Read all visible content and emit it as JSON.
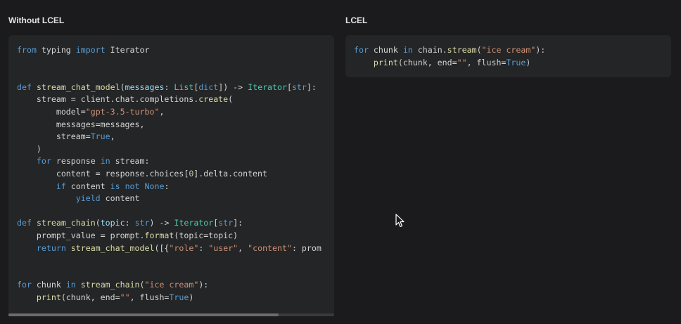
{
  "left_panel": {
    "title": "Without LCEL",
    "code_lines": [
      [
        {
          "t": "from",
          "c": "kw"
        },
        {
          "t": " typing ",
          "c": "pl"
        },
        {
          "t": "import",
          "c": "kw"
        },
        {
          "t": " Iterator",
          "c": "pl"
        }
      ],
      [],
      [],
      [
        {
          "t": "def",
          "c": "kw"
        },
        {
          "t": " ",
          "c": "pl"
        },
        {
          "t": "stream_chat_model",
          "c": "fn"
        },
        {
          "t": "(",
          "c": "pl"
        },
        {
          "t": "messages",
          "c": "id"
        },
        {
          "t": ": ",
          "c": "pl"
        },
        {
          "t": "List",
          "c": "ty"
        },
        {
          "t": "[",
          "c": "pl"
        },
        {
          "t": "dict",
          "c": "kw"
        },
        {
          "t": "]) -> ",
          "c": "pl"
        },
        {
          "t": "Iterator",
          "c": "ty"
        },
        {
          "t": "[",
          "c": "pl"
        },
        {
          "t": "str",
          "c": "kw"
        },
        {
          "t": "]:",
          "c": "pl"
        }
      ],
      [
        {
          "t": "    stream = client.chat.completions.",
          "c": "pl"
        },
        {
          "t": "create",
          "c": "fn"
        },
        {
          "t": "(",
          "c": "pl"
        }
      ],
      [
        {
          "t": "        model=",
          "c": "pl"
        },
        {
          "t": "\"gpt-3.5-turbo\"",
          "c": "st"
        },
        {
          "t": ",",
          "c": "pl"
        }
      ],
      [
        {
          "t": "        messages=messages,",
          "c": "pl"
        }
      ],
      [
        {
          "t": "        stream=",
          "c": "pl"
        },
        {
          "t": "True",
          "c": "kw"
        },
        {
          "t": ",",
          "c": "pl"
        }
      ],
      [
        {
          "t": "    )",
          "c": "pl"
        }
      ],
      [
        {
          "t": "    ",
          "c": "pl"
        },
        {
          "t": "for",
          "c": "kw"
        },
        {
          "t": " response ",
          "c": "pl"
        },
        {
          "t": "in",
          "c": "kw"
        },
        {
          "t": " stream:",
          "c": "pl"
        }
      ],
      [
        {
          "t": "        content = response.choices[",
          "c": "pl"
        },
        {
          "t": "0",
          "c": "nm"
        },
        {
          "t": "].delta.content",
          "c": "pl"
        }
      ],
      [
        {
          "t": "        ",
          "c": "pl"
        },
        {
          "t": "if",
          "c": "kw"
        },
        {
          "t": " content ",
          "c": "pl"
        },
        {
          "t": "is not",
          "c": "kw"
        },
        {
          "t": " ",
          "c": "pl"
        },
        {
          "t": "None",
          "c": "kw"
        },
        {
          "t": ":",
          "c": "pl"
        }
      ],
      [
        {
          "t": "            ",
          "c": "pl"
        },
        {
          "t": "yield",
          "c": "kw"
        },
        {
          "t": " content",
          "c": "pl"
        }
      ],
      [],
      [
        {
          "t": "def",
          "c": "kw"
        },
        {
          "t": " ",
          "c": "pl"
        },
        {
          "t": "stream_chain",
          "c": "fn"
        },
        {
          "t": "(",
          "c": "pl"
        },
        {
          "t": "topic",
          "c": "id"
        },
        {
          "t": ": ",
          "c": "pl"
        },
        {
          "t": "str",
          "c": "kw"
        },
        {
          "t": ") -> ",
          "c": "pl"
        },
        {
          "t": "Iterator",
          "c": "ty"
        },
        {
          "t": "[",
          "c": "pl"
        },
        {
          "t": "str",
          "c": "kw"
        },
        {
          "t": "]:",
          "c": "pl"
        }
      ],
      [
        {
          "t": "    prompt_value = prompt.",
          "c": "pl"
        },
        {
          "t": "format",
          "c": "fn"
        },
        {
          "t": "(topic=topic)",
          "c": "pl"
        }
      ],
      [
        {
          "t": "    ",
          "c": "pl"
        },
        {
          "t": "return",
          "c": "kw"
        },
        {
          "t": " ",
          "c": "pl"
        },
        {
          "t": "stream_chat_model",
          "c": "fn"
        },
        {
          "t": "([{",
          "c": "pl"
        },
        {
          "t": "\"role\"",
          "c": "st"
        },
        {
          "t": ": ",
          "c": "pl"
        },
        {
          "t": "\"user\"",
          "c": "st"
        },
        {
          "t": ", ",
          "c": "pl"
        },
        {
          "t": "\"content\"",
          "c": "st"
        },
        {
          "t": ": prom",
          "c": "pl"
        }
      ],
      [],
      [],
      [
        {
          "t": "for",
          "c": "kw"
        },
        {
          "t": " chunk ",
          "c": "pl"
        },
        {
          "t": "in",
          "c": "kw"
        },
        {
          "t": " ",
          "c": "pl"
        },
        {
          "t": "stream_chain",
          "c": "fn"
        },
        {
          "t": "(",
          "c": "pl"
        },
        {
          "t": "\"ice cream\"",
          "c": "st"
        },
        {
          "t": "):",
          "c": "pl"
        }
      ],
      [
        {
          "t": "    ",
          "c": "pl"
        },
        {
          "t": "print",
          "c": "fn"
        },
        {
          "t": "(chunk, end=",
          "c": "pl"
        },
        {
          "t": "\"\"",
          "c": "st"
        },
        {
          "t": ", flush=",
          "c": "pl"
        },
        {
          "t": "True",
          "c": "kw"
        },
        {
          "t": ")",
          "c": "pl"
        }
      ]
    ],
    "scroll_position": 0.83
  },
  "right_panel": {
    "title": "LCEL",
    "code_lines": [
      [
        {
          "t": "for",
          "c": "kw"
        },
        {
          "t": " chunk ",
          "c": "pl"
        },
        {
          "t": "in",
          "c": "kw"
        },
        {
          "t": " chain.",
          "c": "pl"
        },
        {
          "t": "stream",
          "c": "fn"
        },
        {
          "t": "(",
          "c": "pl"
        },
        {
          "t": "\"ice cream\"",
          "c": "st"
        },
        {
          "t": "):",
          "c": "pl"
        }
      ],
      [
        {
          "t": "    ",
          "c": "pl"
        },
        {
          "t": "print",
          "c": "fn"
        },
        {
          "t": "(chunk, end=",
          "c": "pl"
        },
        {
          "t": "\"\"",
          "c": "st"
        },
        {
          "t": ", flush=",
          "c": "pl"
        },
        {
          "t": "True",
          "c": "kw"
        },
        {
          "t": ")",
          "c": "pl"
        }
      ]
    ]
  },
  "colors": {
    "background": "#1b1b1d",
    "code_background": "#242526",
    "keyword": "#569cd6",
    "function": "#dcdcaa",
    "string": "#ce9178",
    "type": "#4ec9b0"
  }
}
